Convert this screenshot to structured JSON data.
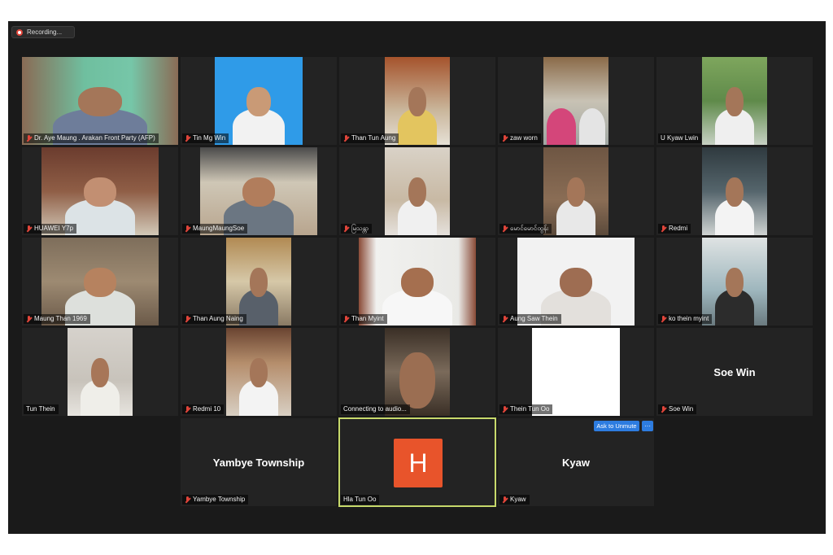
{
  "recording": {
    "label": "Recording..."
  },
  "participants": [
    {
      "name": "Dr. Aye Maung . Arakan Front Party (AFP)",
      "muted": true
    },
    {
      "name": "Tin Mg Win",
      "muted": true
    },
    {
      "name": "Than Tun Aung",
      "muted": true
    },
    {
      "name": "zaw worn",
      "muted": true
    },
    {
      "name": "U Kyaw Lwin",
      "muted": false
    },
    {
      "name": "HUAWEI Y7p",
      "muted": true
    },
    {
      "name": "MaungMaungSoe",
      "muted": true
    },
    {
      "name": "မြသန္တာ",
      "muted": true
    },
    {
      "name": "မောင်မောင်ထွန်း",
      "muted": true
    },
    {
      "name": "Redmi",
      "muted": true
    },
    {
      "name": "Maung Than 1969",
      "muted": true
    },
    {
      "name": "Than Aung Naing",
      "muted": true
    },
    {
      "name": "Than Myint",
      "muted": true
    },
    {
      "name": "Aung Saw Thein",
      "muted": true
    },
    {
      "name": "ko thein myint",
      "muted": true
    },
    {
      "name": "Tun Thein",
      "muted": false
    },
    {
      "name": "Redmi 10",
      "muted": true
    },
    {
      "name": "Connecting to audio...",
      "muted": false
    },
    {
      "name": "Thein Tun Oo",
      "muted": true
    },
    {
      "name": "Soe Win",
      "muted": true,
      "display_name": "Soe Win"
    },
    {
      "name": "Yambye Township",
      "muted": true,
      "display_name": "Yambye Township"
    },
    {
      "name": "Hla Tun Oo",
      "muted": false,
      "avatar_letter": "H",
      "active_speaker": true
    },
    {
      "name": "Kyaw",
      "muted": true,
      "display_name": "Kyaw"
    }
  ],
  "controls": {
    "ask_to_unmute": "Ask to Unmute",
    "more": "···"
  },
  "colors": {
    "mic_muted": "#e0453a",
    "active_border": "#c7d96b",
    "avatar_bg": "#e8542b",
    "button_blue": "#2d7ce0"
  }
}
